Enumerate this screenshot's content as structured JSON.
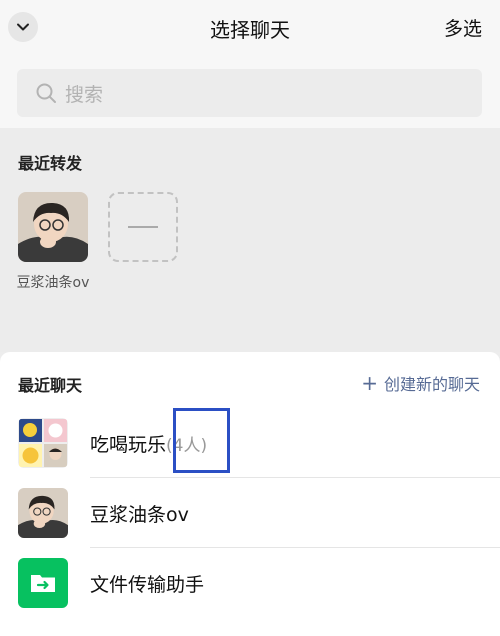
{
  "header": {
    "title": "选择聊天",
    "multi_select": "多选"
  },
  "search": {
    "placeholder": "搜索"
  },
  "recent_forward": {
    "title": "最近转发",
    "items": [
      {
        "name": "豆浆油条ov"
      }
    ]
  },
  "recent_chats": {
    "title": "最近聊天",
    "new_chat_label": "创建新的聊天",
    "items": [
      {
        "name": "吃喝玩乐",
        "count": "(4人)"
      },
      {
        "name": "豆浆油条ov"
      },
      {
        "name": "文件传输助手"
      }
    ]
  },
  "colors": {
    "link": "#576b95",
    "file_helper": "#07c160",
    "highlight": "#2b4fc4"
  }
}
